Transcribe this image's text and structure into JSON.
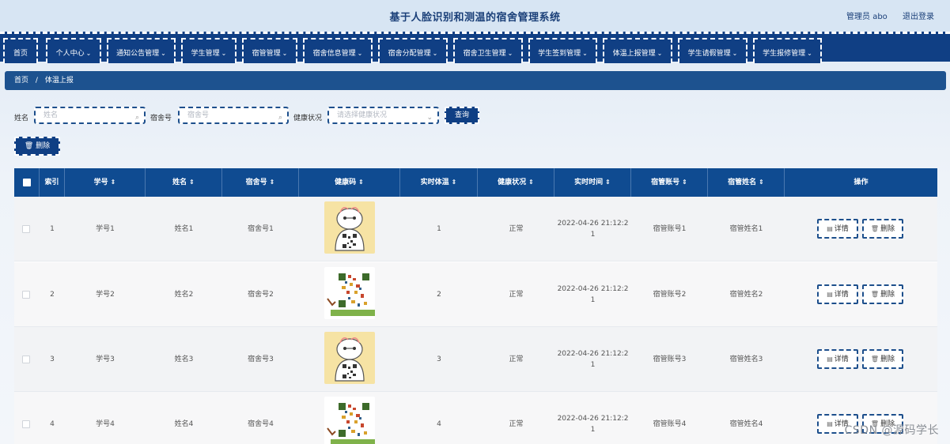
{
  "header": {
    "title": "基于人脸识别和测温的宿舍管理系统",
    "user": "管理员 abo",
    "logout": "退出登录"
  },
  "nav": [
    {
      "label": "首页",
      "has_menu": false
    },
    {
      "label": "个人中心",
      "has_menu": true
    },
    {
      "label": "通知公告管理",
      "has_menu": true
    },
    {
      "label": "学生管理",
      "has_menu": true
    },
    {
      "label": "宿管管理",
      "has_menu": true
    },
    {
      "label": "宿舍信息管理",
      "has_menu": true
    },
    {
      "label": "宿舍分配管理",
      "has_menu": true
    },
    {
      "label": "宿舍卫生管理",
      "has_menu": true
    },
    {
      "label": "学生签到管理",
      "has_menu": true
    },
    {
      "label": "体温上报管理",
      "has_menu": true
    },
    {
      "label": "学生请假管理",
      "has_menu": true
    },
    {
      "label": "学生报修管理",
      "has_menu": true
    }
  ],
  "breadcrumb": {
    "home": "首页",
    "separator": "/",
    "current": "体温上报"
  },
  "search": {
    "name_label": "姓名",
    "name_placeholder": "姓名",
    "dorm_label": "宿舍号",
    "dorm_placeholder": "宿舍号",
    "health_label": "健康状况",
    "health_placeholder": "请选择健康状况",
    "query_button": "查询"
  },
  "toolbar": {
    "delete_button": "删除"
  },
  "table": {
    "columns": [
      "索引",
      "学号",
      "姓名",
      "宿舍号",
      "健康码",
      "实时体温",
      "健康状况",
      "实时时间",
      "宿管账号",
      "宿管姓名",
      "操作"
    ],
    "rows": [
      {
        "index": "1",
        "student_no": "学号1",
        "name": "姓名1",
        "dorm": "宿舍号1",
        "temp": "1",
        "health": "正常",
        "time_1": "2022-04-26 21:12:2",
        "time_2": "1",
        "manager_account": "宿管账号1",
        "manager_name": "宿管姓名1",
        "qr_style": "robot"
      },
      {
        "index": "2",
        "student_no": "学号2",
        "name": "姓名2",
        "dorm": "宿舍号2",
        "temp": "2",
        "health": "正常",
        "time_1": "2022-04-26 21:12:2",
        "time_2": "1",
        "manager_account": "宿管账号2",
        "manager_name": "宿管姓名2",
        "qr_style": "qr"
      },
      {
        "index": "3",
        "student_no": "学号3",
        "name": "姓名3",
        "dorm": "宿舍号3",
        "temp": "3",
        "health": "正常",
        "time_1": "2022-04-26 21:12:2",
        "time_2": "1",
        "manager_account": "宿管账号3",
        "manager_name": "宿管姓名3",
        "qr_style": "robot"
      },
      {
        "index": "4",
        "student_no": "学号4",
        "name": "姓名4",
        "dorm": "宿舍号4",
        "temp": "4",
        "health": "正常",
        "time_1": "2022-04-26 21:12:2",
        "time_2": "1",
        "manager_account": "宿管账号4",
        "manager_name": "宿管姓名4",
        "qr_style": "qr"
      }
    ],
    "detail_button": "详情",
    "delete_button": "删除"
  },
  "watermark": "CSDN @源码学长",
  "colors": {
    "nav_bg": "#103f84",
    "breadcrumb_bg": "#1d528f",
    "table_head_bg": "#0f4b91"
  }
}
